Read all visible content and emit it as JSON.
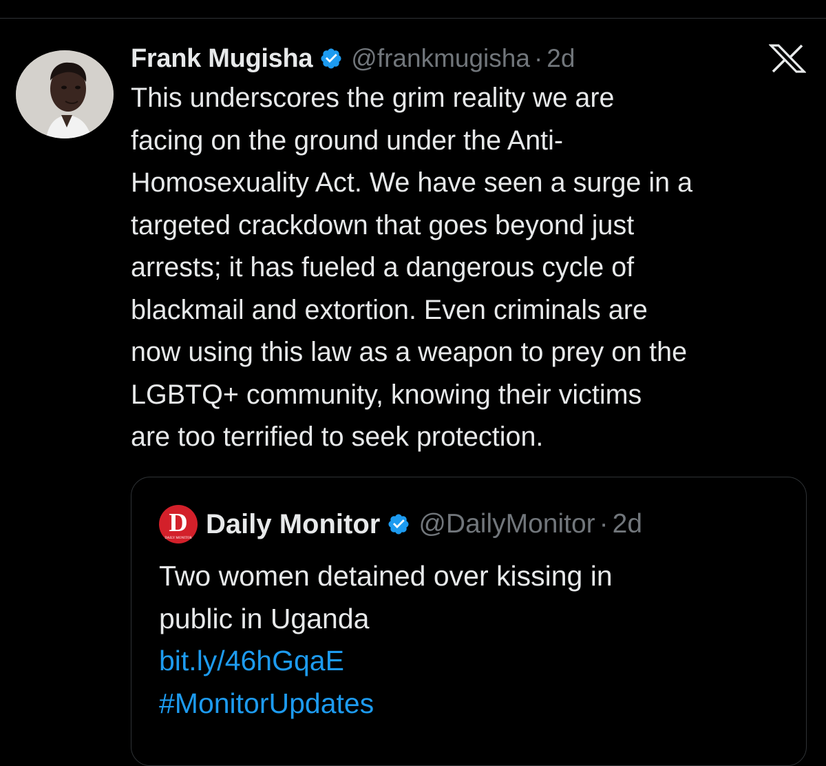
{
  "tweet": {
    "author_name": "Frank Mugisha",
    "handle": "@frankmugisha",
    "separator": "·",
    "time": "2d",
    "text": "This underscores the grim reality we are\nfacing on the ground under the Anti-\nHomosexuality Act. We have seen a surge in a\ntargeted crackdown that goes beyond just\narrests; it has fueled a dangerous cycle of\nblackmail and extortion. Even criminals are\nnow using this law as a weapon to prey on the\nLGBTQ+ community, knowing their victims\nare too terrified to seek protection.",
    "avatar_icon": "user-avatar",
    "verified_icon": "verified-badge-icon",
    "platform_icon": "x-logo-icon"
  },
  "quote": {
    "logo_letter": "D",
    "logo_caption": "DAILY MONITOR",
    "author_name": "Daily Monitor",
    "handle": "@DailyMonitor",
    "separator": "·",
    "time": "2d",
    "text": "Two women detained over kissing in\npublic in Uganda",
    "link": "bit.ly/46hGqaE",
    "hashtag": "#MonitorUpdates"
  },
  "colors": {
    "background": "#000000",
    "text_primary": "#e7e9ea",
    "text_secondary": "#71767b",
    "link": "#1d9bf0",
    "verified": "#1d9bf0",
    "border": "#2f3336",
    "brand_red": "#d3202a"
  }
}
